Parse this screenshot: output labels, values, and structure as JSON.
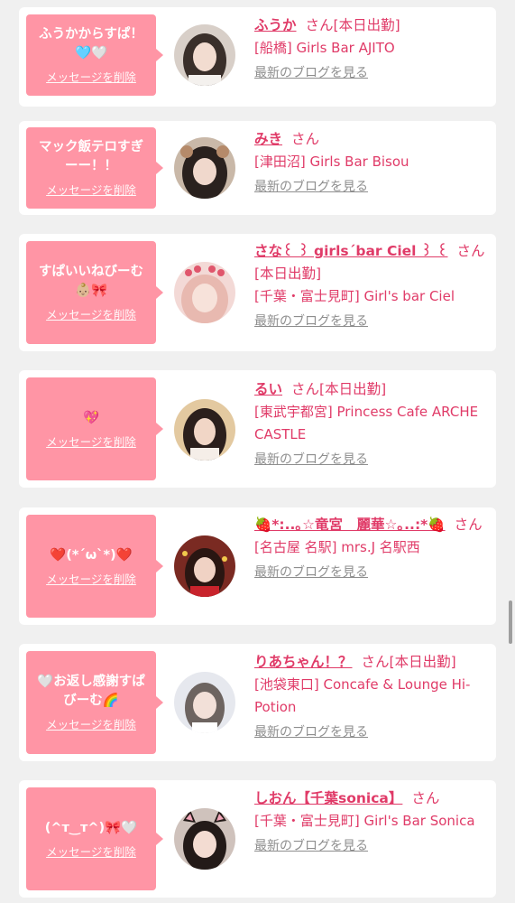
{
  "delete_label": "メッセージを削除",
  "san_label": "さん",
  "blog_label": "最新のブログを見る",
  "items": [
    {
      "message": "ふうかからすぱ！🩵🤍",
      "name": "ふうか",
      "tag": "[本日出勤]",
      "shop": "[船橋] Girls Bar AJITO",
      "avatar": {
        "bg": "#d8cfc8",
        "hair": "#3a2f2a",
        "face": "#f2dcd0"
      }
    },
    {
      "message": "マック飯テロすぎーー！！",
      "name": "みき",
      "tag": "",
      "shop": "[津田沼] Girls Bar Bisou",
      "avatar": {
        "bg": "#c9b8a8",
        "hair": "#2a211e",
        "face": "#f0d8cc"
      }
    },
    {
      "message": "すぱいいねびーむ👶🏼🎀",
      "name": "さな꒰ ꒱ girls´bar Ciel ꒱ ꒰",
      "tag": "[本日出勤]",
      "shop": "[千葉・富士見町] Girl's bar Ciel",
      "avatar": {
        "bg": "#f3d9d6",
        "hair": "#e8b9b0",
        "face": "#f7e2da"
      }
    },
    {
      "message": "💖",
      "name": "るい",
      "tag": "[本日出勤]",
      "shop": "[東武宇都宮] Princess Cafe ARCHE CASTLE",
      "avatar": {
        "bg": "#e3c9a0",
        "hair": "#2b1f1c",
        "face": "#f1d6c6"
      }
    },
    {
      "message": "❤️(*´ω`*)❤️",
      "name": "🍓*:..｡☆竜宮　麗華☆｡..:*🍓",
      "tag": "",
      "shop": "[名古屋 名駅] mrs.J 名駅西",
      "avatar": {
        "bg": "#7a2a22",
        "hair": "#2a1612",
        "face": "#f0d2c4"
      }
    },
    {
      "message": "🤍お返し感謝すぱびーむ🌈",
      "name": "りあちゃん！？",
      "tag": "[本日出勤]",
      "shop": "[池袋東口] Concafe & Lounge Hi-Potion",
      "avatar": {
        "bg": "#e6e8ee",
        "hair": "#6d6460",
        "face": "#f2e0d8"
      }
    },
    {
      "message": "(^ᴛ‿ᴛ^)🎀🤍",
      "name": "しおん【千葉sonica】",
      "tag": "",
      "shop": "[千葉・富士見町] Girl's Bar Sonica",
      "avatar": {
        "bg": "#cfc2bc",
        "hair": "#231a18",
        "face": "#f3dcd2"
      }
    }
  ]
}
